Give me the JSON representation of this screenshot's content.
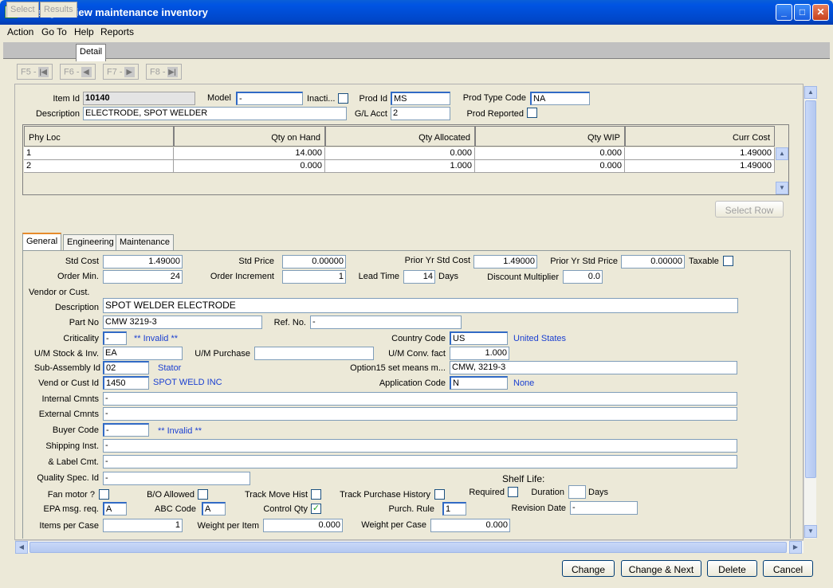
{
  "window": {
    "title": "Change / view maintenance inventory"
  },
  "menu": [
    "Action",
    "Go To",
    "Help",
    "Reports"
  ],
  "tabs": [
    "Select",
    "Results",
    "Detail"
  ],
  "nav": [
    "F5 -",
    "F6 -",
    "F7 -",
    "F8 -"
  ],
  "header": {
    "item_id_label": "Item Id",
    "item_id": "10140",
    "model_label": "Model",
    "model": "-",
    "inactive_label": "Inacti...",
    "prod_id_label": "Prod Id",
    "prod_id": "MS",
    "prod_type_label": "Prod Type Code",
    "prod_type": "NA",
    "description_label": "Description",
    "description": "ELECTRODE, SPOT WELDER",
    "gl_acct_label": "G/L Acct",
    "gl_acct": "2",
    "prod_reported_label": "Prod Reported"
  },
  "grid": {
    "columns": [
      "Phy Loc",
      "Qty on Hand",
      "Qty Allocated",
      "Qty WIP",
      "Curr Cost"
    ],
    "rows": [
      [
        "1",
        "14.000",
        "0.000",
        "0.000",
        "1.49000"
      ],
      [
        "2",
        "0.000",
        "1.000",
        "0.000",
        "1.49000"
      ]
    ],
    "select_row": "Select Row"
  },
  "subtabs": [
    "General",
    "Engineering",
    "Maintenance"
  ],
  "general": {
    "std_cost_label": "Std Cost",
    "std_cost": "1.49000",
    "std_price_label": "Std Price",
    "std_price": "0.00000",
    "prior_cost_label": "Prior Yr Std Cost",
    "prior_cost": "1.49000",
    "prior_price_label": "Prior Yr Std Price",
    "prior_price": "0.00000",
    "taxable_label": "Taxable",
    "order_min_label": "Order Min.",
    "order_min": "24",
    "order_inc_label": "Order Increment",
    "order_inc": "1",
    "lead_time_label": "Lead Time",
    "lead_time": "14",
    "days_label": "Days",
    "disc_label": "Discount Multiplier",
    "disc": "0.0",
    "vendor_label": "Vendor or Cust.",
    "desc_label": "Description",
    "desc": "SPOT WELDER ELECTRODE",
    "part_no_label": "Part No",
    "part_no": "CMW 3219-3",
    "ref_no_label": "Ref. No.",
    "ref_no": "-",
    "crit_label": "Criticality",
    "crit": "-",
    "crit_note": "** Invalid **",
    "country_label": "Country Code",
    "country": "US",
    "country_name": "United States",
    "um_stock_label": "U/M Stock & Inv.",
    "um_stock": "EA",
    "um_purch_label": "U/M Purchase",
    "um_purch": "",
    "um_conv_label": "U/M Conv. fact",
    "um_conv": "1.000",
    "subasm_label": "Sub-Assembly Id",
    "subasm": "02",
    "subasm_name": "Stator",
    "opt15_label": "Option15 set means m...",
    "opt15": "CMW, 3219-3",
    "vend_label": "Vend or Cust Id",
    "vend": "1450",
    "vend_name": "SPOT WELD INC",
    "app_label": "Application Code",
    "app": "N",
    "app_name": "None",
    "int_label": "Internal Cmnts",
    "int": "-",
    "ext_label": "External Cmnts",
    "ext": "-",
    "buyer_label": "Buyer Code",
    "buyer": "-",
    "buyer_note": "** Invalid **",
    "ship_label": "Shipping Inst.",
    "ship": "-",
    "label_label": "& Label Cmt.",
    "label": "-",
    "qual_label": "Quality Spec. Id",
    "qual": "-",
    "shelf_label": "Shelf Life:",
    "req_label": "Required",
    "dur_label": "Duration",
    "dur": "",
    "dur_days": "Days",
    "fan_label": "Fan motor ?",
    "bo_label": "B/O Allowed",
    "track_move_label": "Track Move Hist",
    "track_purch_label": "Track Purchase History",
    "epa_label": "EPA msg. req.",
    "epa": "A",
    "abc_label": "ABC Code",
    "abc": "A",
    "ctrl_label": "Control Qty",
    "ctrl_mark": "✓",
    "purch_rule_label": "Purch. Rule",
    "purch_rule": "1",
    "rev_label": "Revision Date",
    "rev": "-",
    "ipc_label": "Items per Case",
    "ipc": "1",
    "wpi_label": "Weight per Item",
    "wpi": "0.000",
    "wpc_label": "Weight per Case",
    "wpc": "0.000"
  },
  "buttons": {
    "change": "Change",
    "change_next": "Change & Next",
    "delete": "Delete",
    "cancel": "Cancel"
  }
}
